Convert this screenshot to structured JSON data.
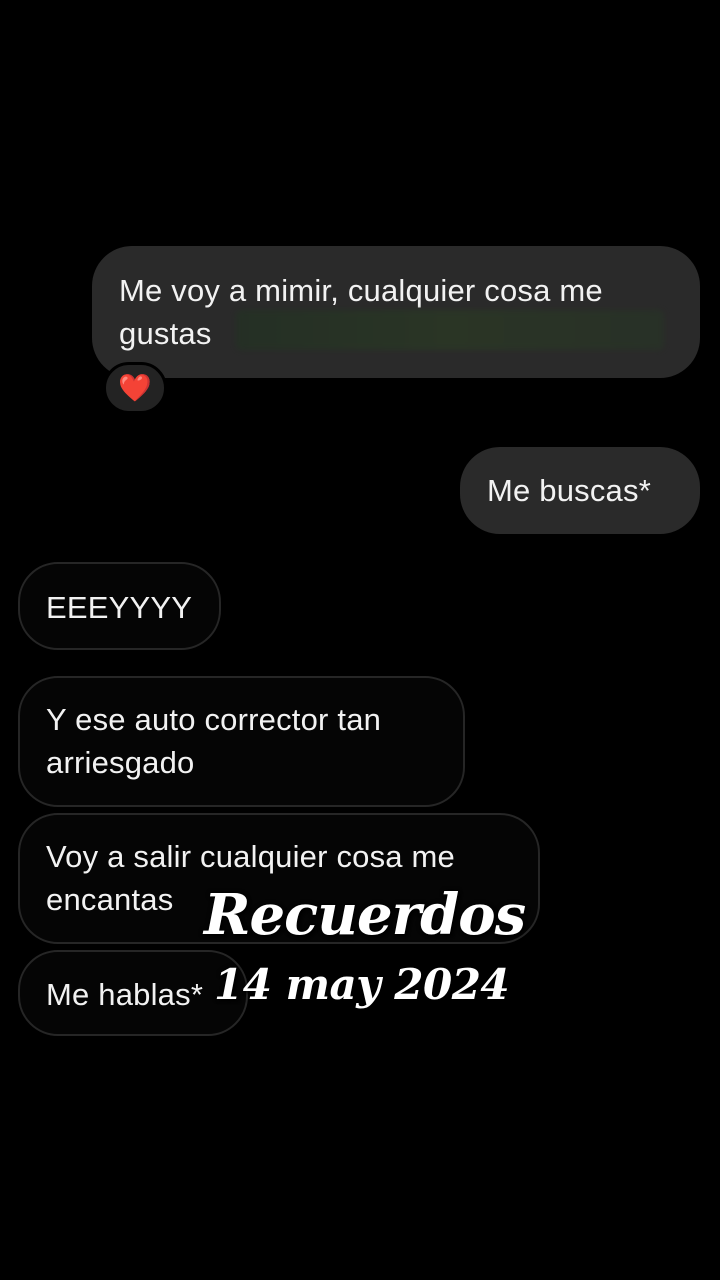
{
  "chat": {
    "messages": [
      {
        "side": "sent",
        "lines": [
          "Me voy a mimir, cualquier cosa me",
          "gustas"
        ],
        "reaction": "heart-emoji"
      },
      {
        "side": "sent",
        "lines": [
          "Me buscas*"
        ]
      },
      {
        "side": "received",
        "lines": [
          "EEEYYYY"
        ]
      },
      {
        "side": "received",
        "lines": [
          "Y ese auto corrector tan",
          "arriesgado"
        ]
      },
      {
        "side": "received",
        "lines": [
          "Voy a salir cualquier cosa me",
          "encantas"
        ]
      },
      {
        "side": "received",
        "lines": [
          "Me hablas*"
        ]
      }
    ],
    "reaction_glyph": "❤️"
  },
  "overlay": {
    "title": "Recuerdos",
    "date": "14 may 2024"
  },
  "colors": {
    "background": "#000000",
    "sent_bubble": "#2a2a2a",
    "received_border": "#262626",
    "text": "#f2f2f2",
    "heart": "#e8222e"
  }
}
